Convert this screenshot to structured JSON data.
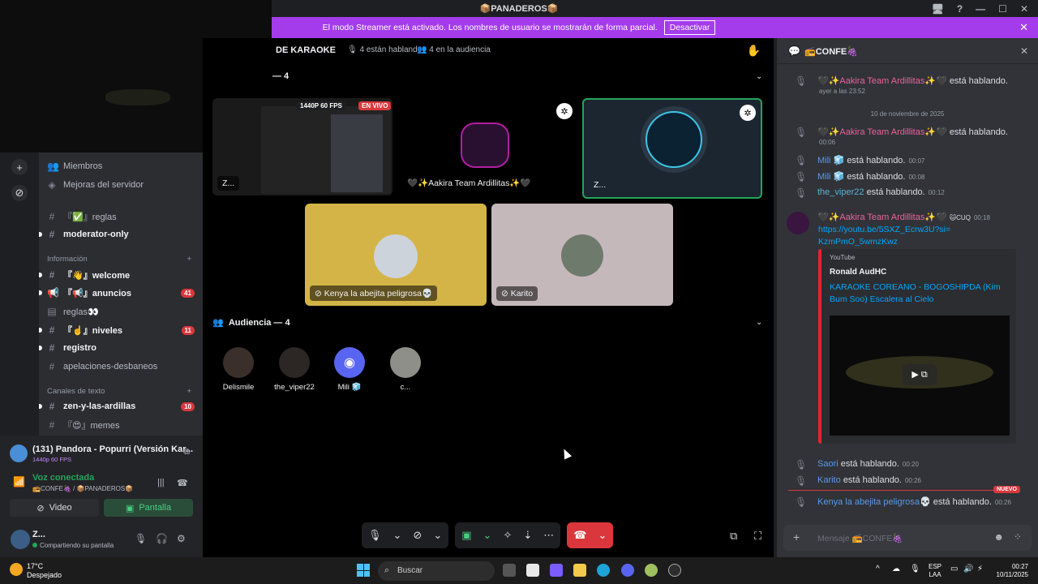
{
  "window": {
    "title": "📦PANADEROS📦"
  },
  "banner": {
    "text": "El modo Streamer está activado. Los nombres de usuario se mostrarán de forma parcial.",
    "button": "Desactivar"
  },
  "channels": {
    "members": "Miembros",
    "boosts": "Mejoras del servidor",
    "items": [
      {
        "icon": "#",
        "label": "『✅』reglas",
        "top": 0
      },
      {
        "icon": "#",
        "label": "moderator-only",
        "bold": true
      }
    ],
    "cat_info": "Información",
    "info_items": [
      {
        "label": "『👋』welcome"
      },
      {
        "label": "『📢』anuncios",
        "badge": "41"
      },
      {
        "label": "reglas👀"
      },
      {
        "label": "『☝️』niveles",
        "badge": "11"
      },
      {
        "label": "registro"
      },
      {
        "label": "apelaciones-desbaneos"
      }
    ],
    "cat_text": "Canales de texto",
    "text_items": [
      {
        "label": "zen-y-las-ardillas",
        "badge": "10"
      },
      {
        "label": "『😍』memes"
      }
    ]
  },
  "now_playing": {
    "title": "(131) Pandora - Popurri (Versión Kar...",
    "quality": "1440p 60 FPS"
  },
  "voice": {
    "status": "Voz conectada",
    "location": "📻CONFE🍇 / 📦PANADEROS📦",
    "video_btn": "Video",
    "screen_btn": "Pantalla"
  },
  "user": {
    "name": "Z...",
    "status": "Compartiendo su pantalla"
  },
  "stage": {
    "title": "DE KARAOKE",
    "speaking": "4 están hablando",
    "audience_count": "4 en la audiencia",
    "speakers_label": "— 4",
    "stream_badge": "1440P 60 FPS",
    "live_badge": "EN VIVO",
    "tiles": {
      "stream": "Z...",
      "aakira": "🖤✨Aakira Team Ardillitas✨🖤",
      "z": "Z...",
      "kenya": "Kenya la abejita peligrosa💀",
      "karito": "Karito"
    },
    "audience_label": "Audiencia — 4",
    "audience": [
      "Delismile",
      "the_viper22",
      "Mili 🧊",
      "c..."
    ]
  },
  "chat": {
    "title": "📻CONFE🍇",
    "speaking": "está hablando.",
    "m1": {
      "name": "🖤✨Aakira Team Ardillitas✨🖤",
      "time": "ayer a las 23:52"
    },
    "date_sep": "10 de noviembre de 2025",
    "m2": {
      "name": "🖤✨Aakira Team Ardillitas✨🖤",
      "time": "00:06"
    },
    "m3": {
      "name": "Mili 🧊",
      "time": "00:07"
    },
    "m4": {
      "name": "Mili 🧊",
      "time": "00:08"
    },
    "m5": {
      "name": "the_viper22",
      "time": "00:12"
    },
    "m6": {
      "name": "🖤✨Aakira Team Ardillitas✨🖤",
      "tag": "🐱CUQ",
      "time": "00:18",
      "link": "https://youtu.be/5SXZ_Ecrw3U?si=KzmPmO_5wmzKwz"
    },
    "embed": {
      "source": "YouTube",
      "author": "Ronald AudHC",
      "title": "KARAOKE COREANO - BOGOSHIPDA (Kim Bum Soo) Escalera al Cielo"
    },
    "m7": {
      "name": "Saori",
      "time": "00:20"
    },
    "m8": {
      "name": "Karito",
      "time": "00:26"
    },
    "new_tag": "NUEVO",
    "m9": {
      "name": "Kenya la abejita peligrosa💀",
      "time": "00:26"
    },
    "input_placeholder": "Mensaje 📻CONFE🍇"
  },
  "taskbar": {
    "temp": "17°C",
    "weather": "Despejado",
    "search": "Buscar",
    "lang1": "ESP",
    "lang2": "LAA",
    "time": "00:27",
    "date": "10/11/2025"
  }
}
